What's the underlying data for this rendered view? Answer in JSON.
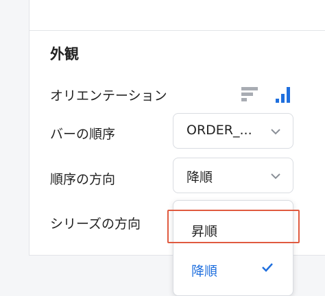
{
  "section": {
    "title": "外観"
  },
  "rows": {
    "orientation_label": "オリエンテーション",
    "bar_order_label": "バーの順序",
    "order_direction_label": "順序の方向",
    "series_direction_label": "シリーズの方向"
  },
  "selects": {
    "bar_order_value": "ORDER_...",
    "order_direction_value": "降順"
  },
  "dropdown": {
    "options": [
      {
        "label": "昇順",
        "selected": false
      },
      {
        "label": "降順",
        "selected": true
      }
    ]
  },
  "colors": {
    "accent": "#1f6fde",
    "inactive_icon": "#a8acb3",
    "highlight_border": "#e05a3f"
  },
  "icons": {
    "orientation_horizontal": "horizontal-bars-icon",
    "orientation_vertical": "vertical-bars-icon",
    "select_chevron": "chevron-down-icon",
    "selected_check": "check-icon"
  }
}
